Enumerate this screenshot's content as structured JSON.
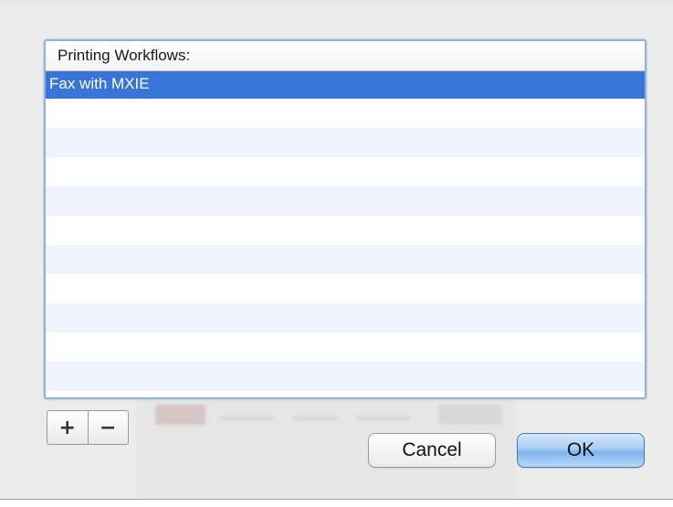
{
  "list": {
    "header": "Printing Workflows:",
    "items": [
      {
        "label": "Fax with MXIE",
        "selected": true
      }
    ],
    "empty_rows": 9
  },
  "toolbar": {
    "add_label": "+",
    "remove_label": "−"
  },
  "buttons": {
    "cancel_label": "Cancel",
    "ok_label": "OK"
  },
  "colors": {
    "selection": "#3875d7",
    "alt_row": "#eef3fd",
    "focus_ring": "#8eb2dc",
    "default_button": "#7fb4ec"
  }
}
